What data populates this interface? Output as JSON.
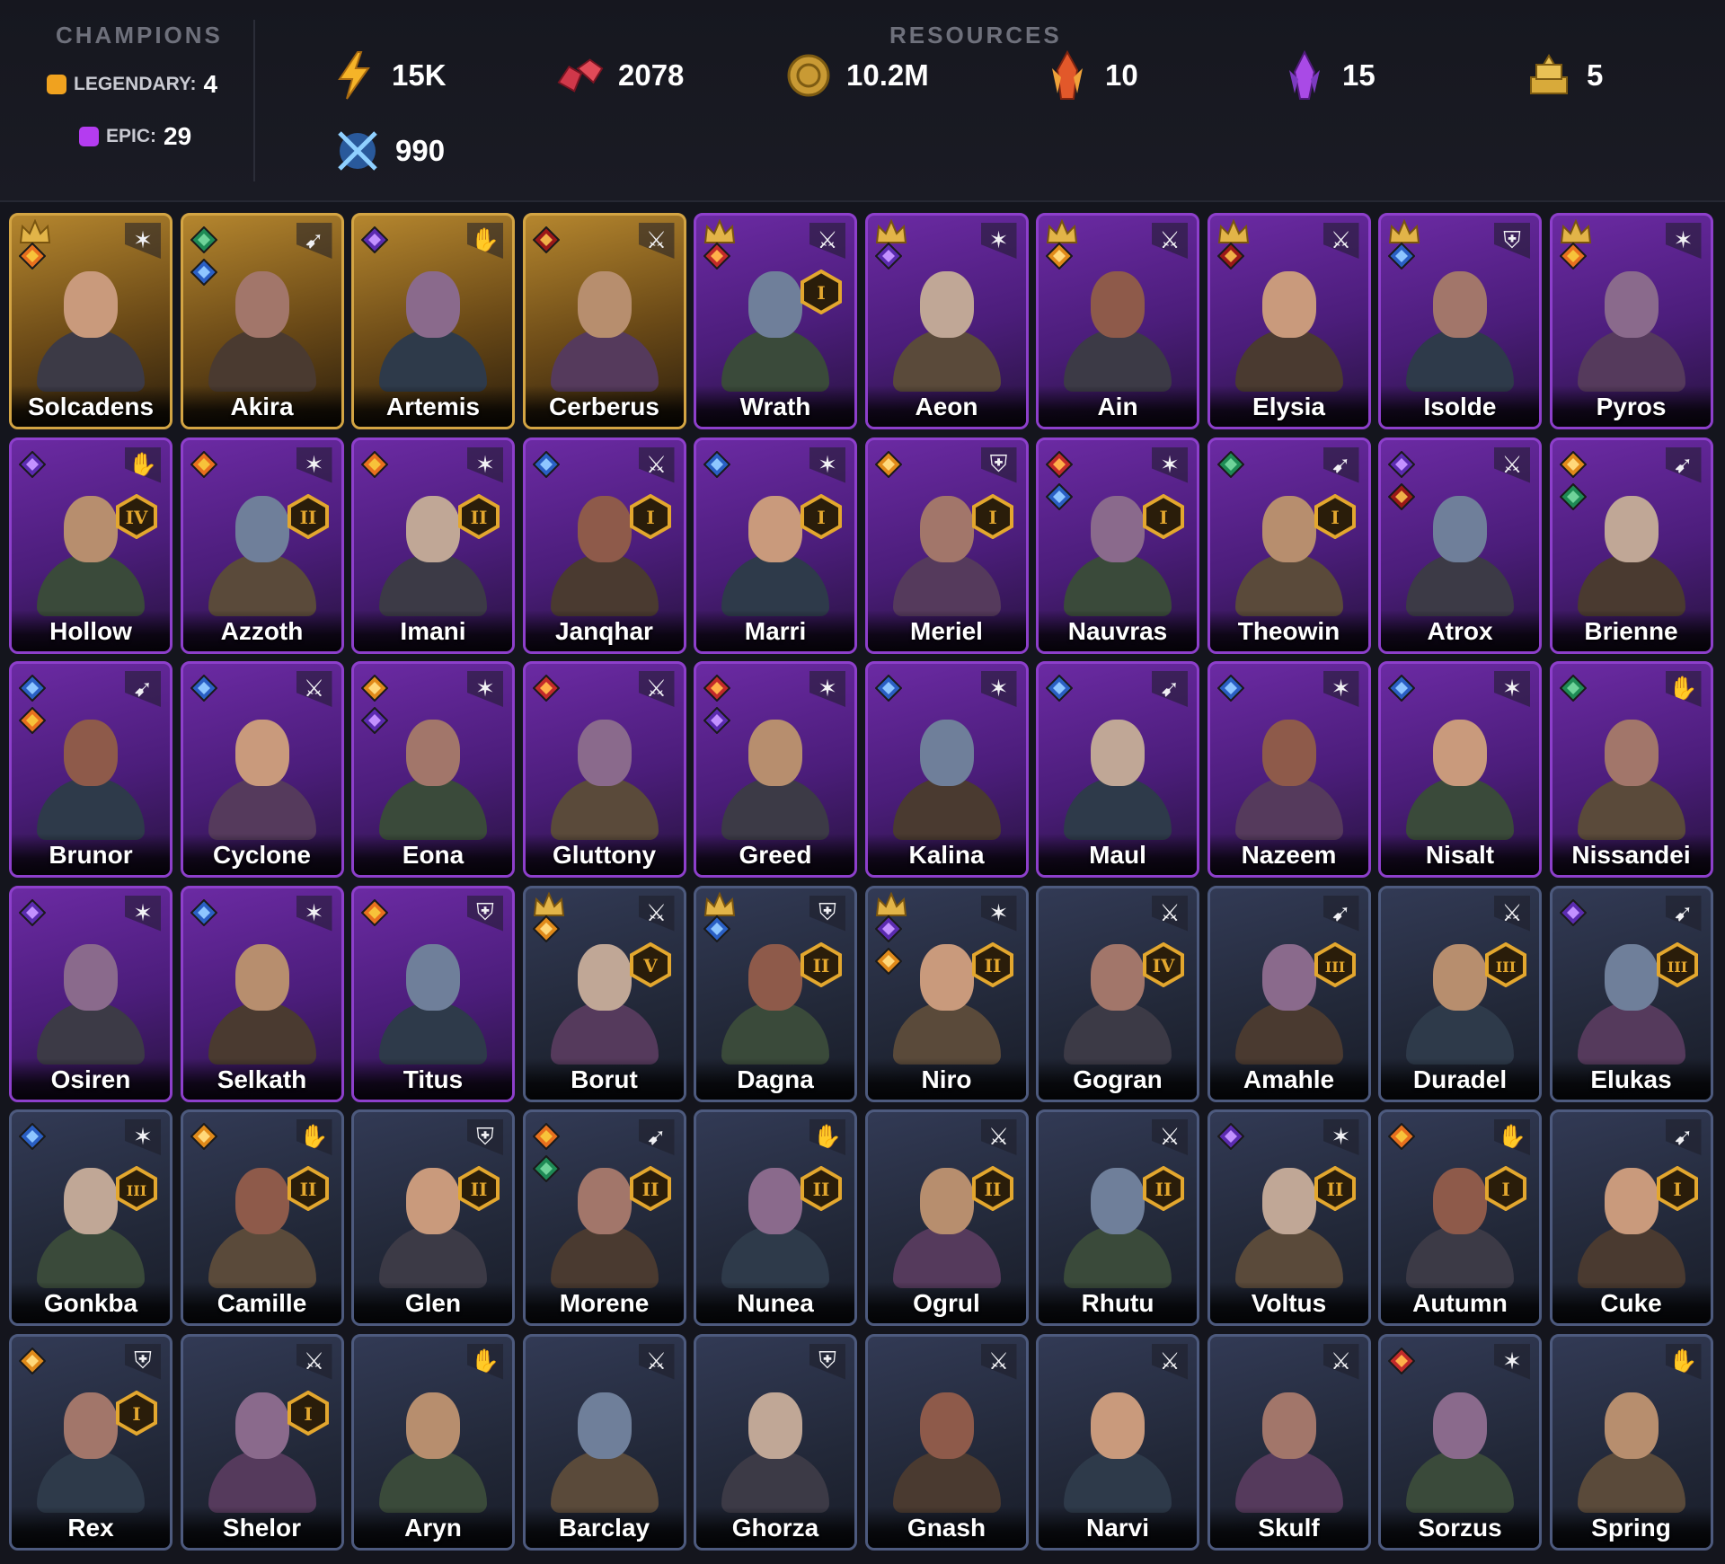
{
  "champions": {
    "title": "CHAMPIONS",
    "legendary": {
      "label": "LEGENDARY:",
      "count": "4",
      "color": "#f0a21f"
    },
    "epic": {
      "label": "EPIC:",
      "count": "29",
      "color": "#b43cf0"
    }
  },
  "resources": {
    "title": "RESOURCES",
    "items": [
      {
        "icon": "energy-icon",
        "value": "15K"
      },
      {
        "icon": "ruby-icon",
        "value": "2078"
      },
      {
        "icon": "gold-coin-icon",
        "value": "10.2M"
      },
      {
        "icon": "flame-shard-icon",
        "value": "10"
      },
      {
        "icon": "purple-shard-icon",
        "value": "15"
      },
      {
        "icon": "gold-bars-icon",
        "value": "5"
      },
      {
        "icon": "arena-token-icon",
        "value": "990"
      }
    ]
  },
  "colors": {
    "legendary": "#d3a443",
    "epic": "#8d3fcb",
    "rare": "#4d5a7e",
    "rank_gold": "#e3a72e"
  },
  "cards": [
    {
      "name": "Solcadens",
      "rarity": "legendary",
      "crown": true,
      "aff": [
        "flame"
      ],
      "role": "staff",
      "rank": ""
    },
    {
      "name": "Akira",
      "rarity": "legendary",
      "crown": false,
      "aff": [
        "nature",
        "water"
      ],
      "role": "bow",
      "rank": ""
    },
    {
      "name": "Artemis",
      "rarity": "legendary",
      "crown": false,
      "aff": [
        "void"
      ],
      "role": "hands",
      "rank": ""
    },
    {
      "name": "Cerberus",
      "rarity": "legendary",
      "crown": false,
      "aff": [
        "infernal"
      ],
      "role": "sword",
      "rank": ""
    },
    {
      "name": "Wrath",
      "rarity": "epic",
      "crown": true,
      "aff": [
        "chaos"
      ],
      "role": "sword",
      "rank": "I"
    },
    {
      "name": "Aeon",
      "rarity": "epic",
      "crown": true,
      "aff": [
        "void"
      ],
      "role": "staff",
      "rank": ""
    },
    {
      "name": "Ain",
      "rarity": "epic",
      "crown": true,
      "aff": [
        "solar"
      ],
      "role": "sword",
      "rank": ""
    },
    {
      "name": "Elysia",
      "rarity": "epic",
      "crown": true,
      "aff": [
        "infernal"
      ],
      "role": "sword",
      "rank": ""
    },
    {
      "name": "Isolde",
      "rarity": "epic",
      "crown": true,
      "aff": [
        "water"
      ],
      "role": "shield",
      "rank": ""
    },
    {
      "name": "Pyros",
      "rarity": "epic",
      "crown": true,
      "aff": [
        "flame"
      ],
      "role": "staff",
      "rank": ""
    },
    {
      "name": "Hollow",
      "rarity": "epic",
      "crown": false,
      "aff": [
        "void"
      ],
      "role": "hands",
      "rank": "IV"
    },
    {
      "name": "Azzoth",
      "rarity": "epic",
      "crown": false,
      "aff": [
        "flame"
      ],
      "role": "staff",
      "rank": "II"
    },
    {
      "name": "Imani",
      "rarity": "epic",
      "crown": false,
      "aff": [
        "flame"
      ],
      "role": "staff",
      "rank": "II"
    },
    {
      "name": "Janqhar",
      "rarity": "epic",
      "crown": false,
      "aff": [
        "water"
      ],
      "role": "sword",
      "rank": "I"
    },
    {
      "name": "Marri",
      "rarity": "epic",
      "crown": false,
      "aff": [
        "water"
      ],
      "role": "staff",
      "rank": "I"
    },
    {
      "name": "Meriel",
      "rarity": "epic",
      "crown": false,
      "aff": [
        "solar"
      ],
      "role": "shield",
      "rank": "I"
    },
    {
      "name": "Nauvras",
      "rarity": "epic",
      "crown": false,
      "aff": [
        "chaos",
        "water"
      ],
      "role": "staff",
      "rank": "I"
    },
    {
      "name": "Theowin",
      "rarity": "epic",
      "crown": false,
      "aff": [
        "nature"
      ],
      "role": "bow",
      "rank": "I"
    },
    {
      "name": "Atrox",
      "rarity": "epic",
      "crown": false,
      "aff": [
        "void",
        "infernal"
      ],
      "role": "sword",
      "rank": ""
    },
    {
      "name": "Brienne",
      "rarity": "epic",
      "crown": false,
      "aff": [
        "solar",
        "nature"
      ],
      "role": "bow",
      "rank": ""
    },
    {
      "name": "Brunor",
      "rarity": "epic",
      "crown": false,
      "aff": [
        "water",
        "flame"
      ],
      "role": "bow",
      "rank": ""
    },
    {
      "name": "Cyclone",
      "rarity": "epic",
      "crown": false,
      "aff": [
        "water"
      ],
      "role": "sword",
      "rank": ""
    },
    {
      "name": "Eona",
      "rarity": "epic",
      "crown": false,
      "aff": [
        "solar",
        "void"
      ],
      "role": "staff",
      "rank": ""
    },
    {
      "name": "Gluttony",
      "rarity": "epic",
      "crown": false,
      "aff": [
        "chaos"
      ],
      "role": "sword",
      "rank": ""
    },
    {
      "name": "Greed",
      "rarity": "epic",
      "crown": false,
      "aff": [
        "chaos",
        "void"
      ],
      "role": "staff",
      "rank": ""
    },
    {
      "name": "Kalina",
      "rarity": "epic",
      "crown": false,
      "aff": [
        "water"
      ],
      "role": "staff",
      "rank": ""
    },
    {
      "name": "Maul",
      "rarity": "epic",
      "crown": false,
      "aff": [
        "water"
      ],
      "role": "bow",
      "rank": ""
    },
    {
      "name": "Nazeem",
      "rarity": "epic",
      "crown": false,
      "aff": [
        "water"
      ],
      "role": "staff",
      "rank": ""
    },
    {
      "name": "Nisalt",
      "rarity": "epic",
      "crown": false,
      "aff": [
        "water"
      ],
      "role": "staff",
      "rank": ""
    },
    {
      "name": "Nissandei",
      "rarity": "epic",
      "crown": false,
      "aff": [
        "nature"
      ],
      "role": "hands",
      "rank": ""
    },
    {
      "name": "Osiren",
      "rarity": "epic",
      "crown": false,
      "aff": [
        "void"
      ],
      "role": "staff",
      "rank": ""
    },
    {
      "name": "Selkath",
      "rarity": "epic",
      "crown": false,
      "aff": [
        "water"
      ],
      "role": "staff",
      "rank": ""
    },
    {
      "name": "Titus",
      "rarity": "epic",
      "crown": false,
      "aff": [
        "flame"
      ],
      "role": "shield",
      "rank": ""
    },
    {
      "name": "Borut",
      "rarity": "rare",
      "crown": true,
      "aff": [
        "solar"
      ],
      "role": "sword",
      "rank": "V"
    },
    {
      "name": "Dagna",
      "rarity": "rare",
      "crown": true,
      "aff": [
        "water"
      ],
      "role": "shield",
      "rank": "II"
    },
    {
      "name": "Niro",
      "rarity": "rare",
      "crown": true,
      "aff": [
        "void",
        "solar"
      ],
      "role": "staff",
      "rank": "II"
    },
    {
      "name": "Gogran",
      "rarity": "rare",
      "crown": false,
      "aff": [],
      "role": "sword",
      "rank": "IV"
    },
    {
      "name": "Amahle",
      "rarity": "rare",
      "crown": false,
      "aff": [],
      "role": "bow",
      "rank": "III"
    },
    {
      "name": "Duradel",
      "rarity": "rare",
      "crown": false,
      "aff": [],
      "role": "sword",
      "rank": "III"
    },
    {
      "name": "Elukas",
      "rarity": "rare",
      "crown": false,
      "aff": [
        "void"
      ],
      "role": "bow",
      "rank": "III"
    },
    {
      "name": "Gonkba",
      "rarity": "rare",
      "crown": false,
      "aff": [
        "water"
      ],
      "role": "staff",
      "rank": "III"
    },
    {
      "name": "Camille",
      "rarity": "rare",
      "crown": false,
      "aff": [
        "solar"
      ],
      "role": "hands",
      "rank": "II"
    },
    {
      "name": "Glen",
      "rarity": "rare",
      "crown": false,
      "aff": [],
      "role": "shield",
      "rank": "II"
    },
    {
      "name": "Morene",
      "rarity": "rare",
      "crown": false,
      "aff": [
        "flame",
        "nature"
      ],
      "role": "bow",
      "rank": "II"
    },
    {
      "name": "Nunea",
      "rarity": "rare",
      "crown": false,
      "aff": [],
      "role": "hands",
      "rank": "II"
    },
    {
      "name": "Ogrul",
      "rarity": "rare",
      "crown": false,
      "aff": [],
      "role": "sword",
      "rank": "II"
    },
    {
      "name": "Rhutu",
      "rarity": "rare",
      "crown": false,
      "aff": [],
      "role": "sword",
      "rank": "II"
    },
    {
      "name": "Voltus",
      "rarity": "rare",
      "crown": false,
      "aff": [
        "void"
      ],
      "role": "staff",
      "rank": "II"
    },
    {
      "name": "Autumn",
      "rarity": "rare",
      "crown": false,
      "aff": [
        "flame"
      ],
      "role": "hands",
      "rank": "I"
    },
    {
      "name": "Cuke",
      "rarity": "rare",
      "crown": false,
      "aff": [],
      "role": "bow",
      "rank": "I"
    },
    {
      "name": "Rex",
      "rarity": "rare",
      "crown": false,
      "aff": [
        "solar"
      ],
      "role": "shield",
      "rank": "I"
    },
    {
      "name": "Shelor",
      "rarity": "rare",
      "crown": false,
      "aff": [],
      "role": "sword",
      "rank": "I"
    },
    {
      "name": "Aryn",
      "rarity": "rare",
      "crown": false,
      "aff": [],
      "role": "hands",
      "rank": ""
    },
    {
      "name": "Barclay",
      "rarity": "rare",
      "crown": false,
      "aff": [],
      "role": "sword",
      "rank": ""
    },
    {
      "name": "Ghorza",
      "rarity": "rare",
      "crown": false,
      "aff": [],
      "role": "shield",
      "rank": ""
    },
    {
      "name": "Gnash",
      "rarity": "rare",
      "crown": false,
      "aff": [],
      "role": "sword",
      "rank": ""
    },
    {
      "name": "Narvi",
      "rarity": "rare",
      "crown": false,
      "aff": [],
      "role": "sword",
      "rank": ""
    },
    {
      "name": "Skulf",
      "rarity": "rare",
      "crown": false,
      "aff": [],
      "role": "sword",
      "rank": ""
    },
    {
      "name": "Sorzus",
      "rarity": "rare",
      "crown": false,
      "aff": [
        "chaos"
      ],
      "role": "staff",
      "rank": ""
    },
    {
      "name": "Spring",
      "rarity": "rare",
      "crown": false,
      "aff": [],
      "role": "hands",
      "rank": ""
    }
  ]
}
